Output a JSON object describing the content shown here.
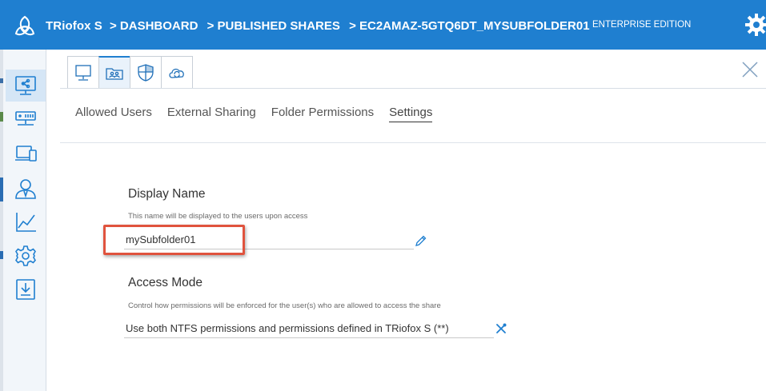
{
  "header": {
    "brand": "TRiofox S",
    "breadcrumbs": [
      "> DASHBOARD",
      "> PUBLISHED SHARES",
      "> EC2AMAZ-5GTQ6DT_MYSUBFOLDER01"
    ],
    "edition": "ENTERPRISE EDITION",
    "bg_color": "#1f7fd0"
  },
  "sidebar": {
    "items": [
      {
        "icon": "share-folder-icon",
        "active": true
      },
      {
        "icon": "server-icon",
        "active": false
      },
      {
        "icon": "devices-icon",
        "active": false
      },
      {
        "icon": "user-icon",
        "active": false
      },
      {
        "icon": "chart-icon",
        "active": false
      },
      {
        "icon": "settings-icon",
        "active": false
      },
      {
        "icon": "download-icon",
        "active": false
      }
    ]
  },
  "icon_tabs": [
    {
      "icon": "computer-icon",
      "active": false
    },
    {
      "icon": "users-folder-icon",
      "active": true
    },
    {
      "icon": "shield-icon",
      "active": false
    },
    {
      "icon": "cloud-sync-icon",
      "active": false
    }
  ],
  "subtabs": [
    {
      "label": "Allowed Users",
      "active": false
    },
    {
      "label": "External Sharing",
      "active": false
    },
    {
      "label": "Folder Permissions",
      "active": false
    },
    {
      "label": "Settings",
      "active": true
    }
  ],
  "display_name": {
    "title": "Display Name",
    "hint": "This name will be displayed to the users upon access",
    "value": "mySubfolder01"
  },
  "access_mode": {
    "title": "Access Mode",
    "hint": "Control how permissions will be enforced for the user(s) who are allowed to access the share",
    "value": "Use both NTFS permissions and permissions defined in TRiofox S  (**)"
  },
  "accent_color": "#1f7fd0",
  "highlight_color": "#e0533e"
}
